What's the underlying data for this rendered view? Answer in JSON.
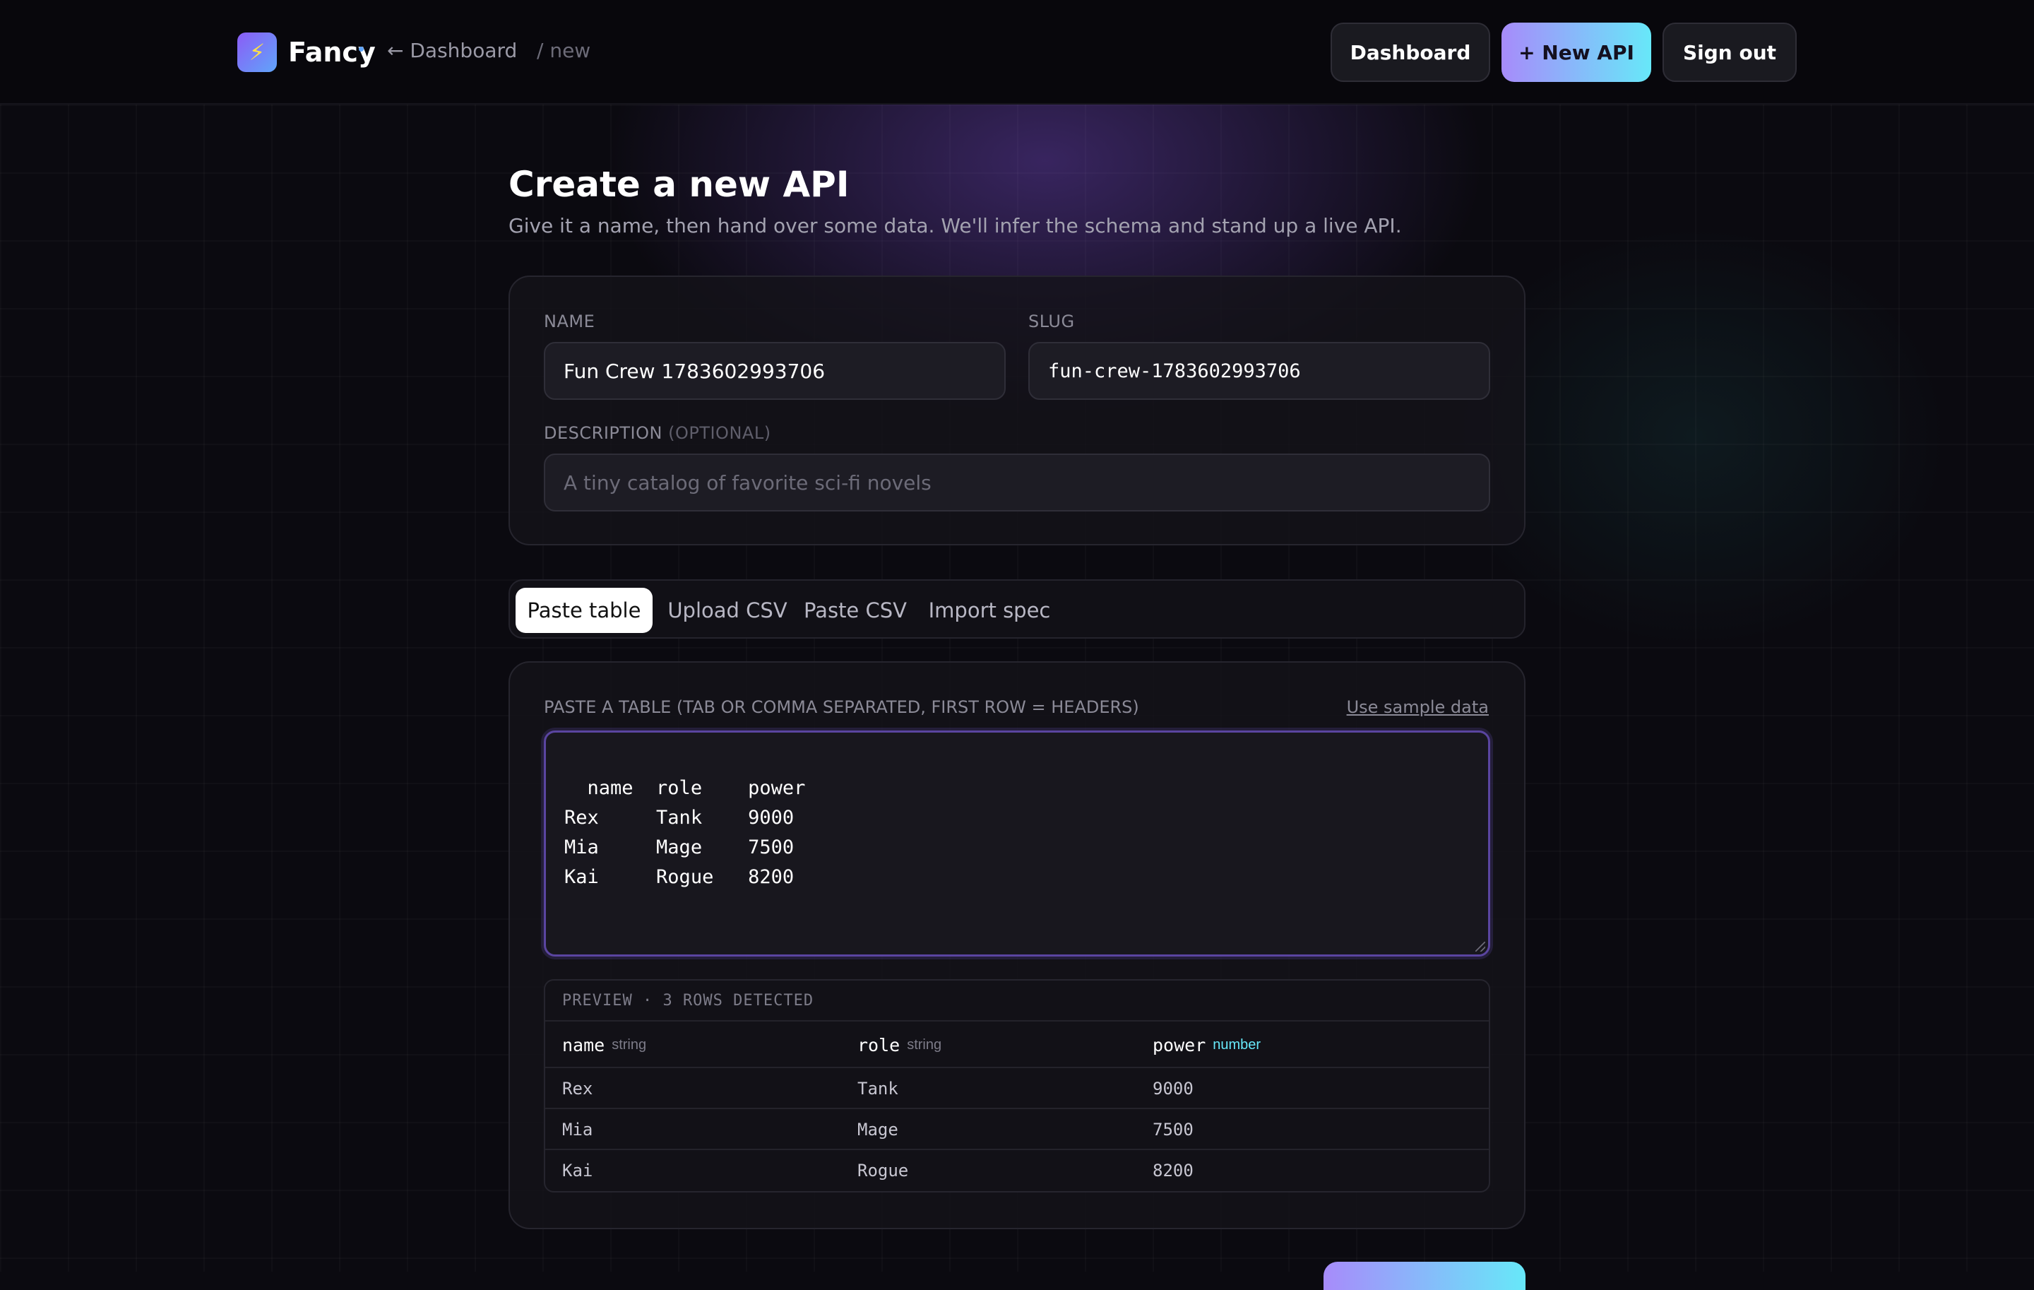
{
  "header": {
    "brand": "Fancy",
    "brand_icon": "lightning-icon",
    "back_link": "← Dashboard",
    "crumb": "/ new",
    "buttons": {
      "dashboard": "Dashboard",
      "new_api": "+ New API",
      "sign_out": "Sign out"
    }
  },
  "page": {
    "title": "Create a new API",
    "subtitle": "Give it a name, then hand over some data. We'll infer the schema and stand up a live API."
  },
  "form": {
    "name_label": "NAME",
    "name_value": "Fun Crew 1783602993706",
    "slug_label": "SLUG",
    "slug_value": "fun-crew-1783602993706",
    "description_label": "DESCRIPTION",
    "description_optional": "(OPTIONAL)",
    "description_placeholder": "A tiny catalog of favorite sci-fi novels"
  },
  "tabs": [
    {
      "label": "Paste table",
      "active": true
    },
    {
      "label": "Upload CSV",
      "active": false
    },
    {
      "label": "Paste CSV",
      "active": false
    },
    {
      "label": "Import spec",
      "active": false
    }
  ],
  "paste": {
    "label": "PASTE A TABLE (TAB OR COMMA SEPARATED, FIRST ROW = HEADERS)",
    "sample_link": "Use sample data",
    "text": "name\trole\tpower\nRex\tTank\t9000\nMia\tMage\t7500\nKai\tRogue\t8200"
  },
  "preview": {
    "title": "PREVIEW · 3 ROWS DETECTED",
    "columns": [
      {
        "name": "name",
        "type": "string"
      },
      {
        "name": "role",
        "type": "string"
      },
      {
        "name": "power",
        "type": "number"
      }
    ],
    "rows": [
      [
        "Rex",
        "Tank",
        "9000"
      ],
      [
        "Mia",
        "Mage",
        "7500"
      ],
      [
        "Kai",
        "Rogue",
        "8200"
      ]
    ]
  },
  "colors": {
    "accent_start": "#a78bfa",
    "accent_end": "#67e8f9",
    "number_type": "#67e8f9",
    "background": "#0b0a10"
  }
}
